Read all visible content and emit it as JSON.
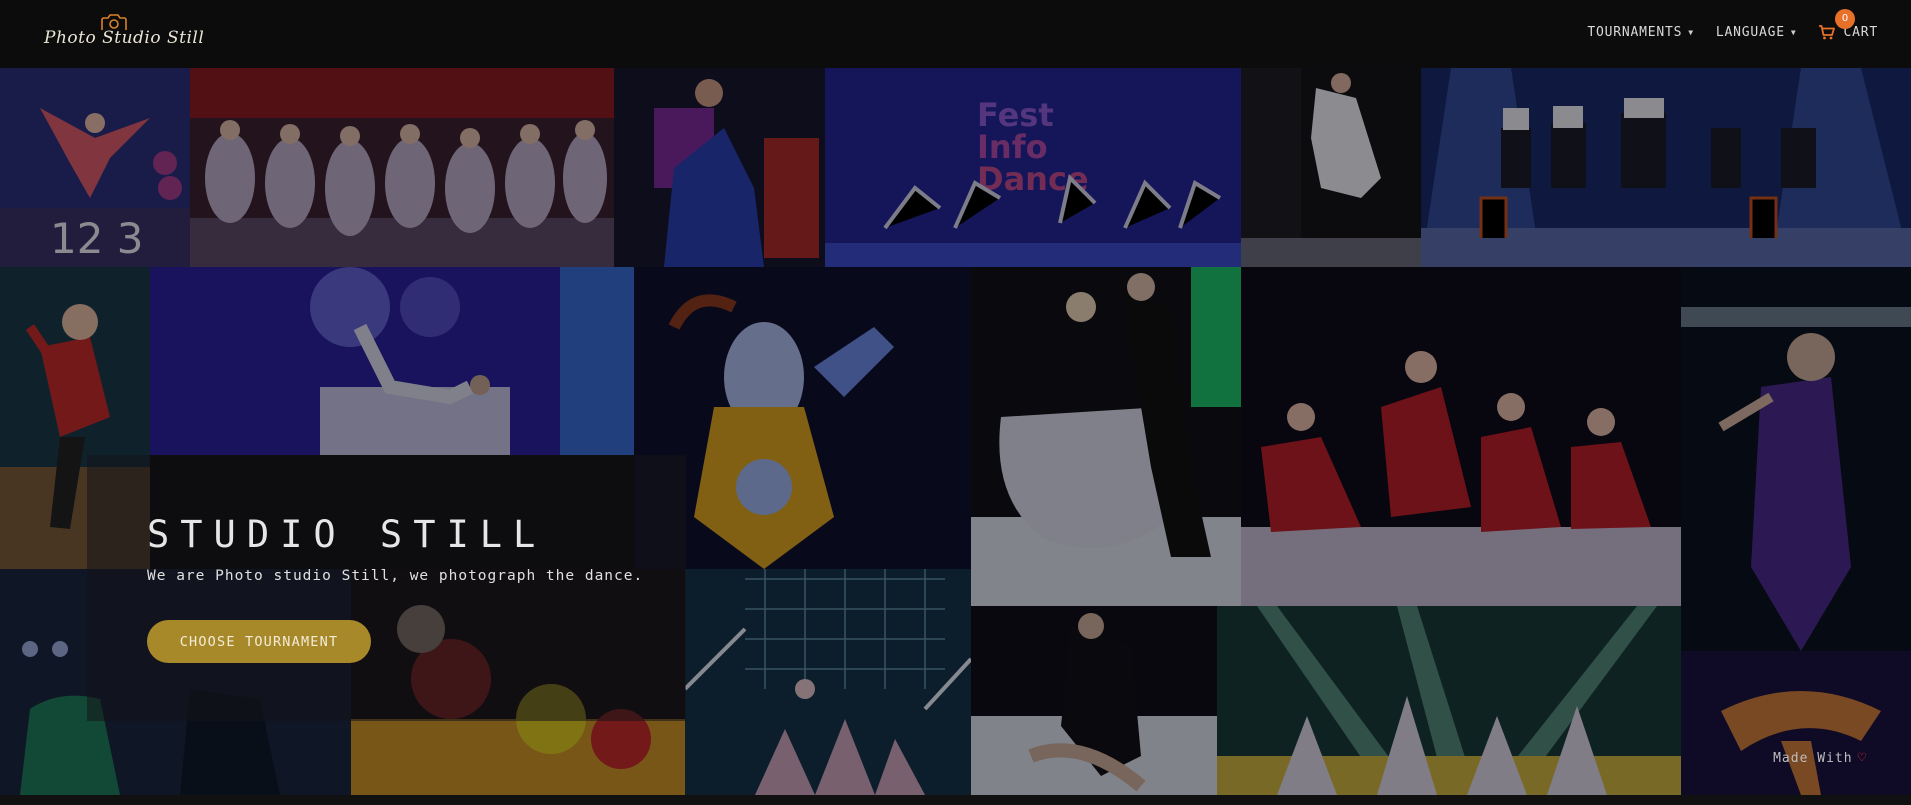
{
  "brand": {
    "name": "Photo Studio Still"
  },
  "nav": {
    "tournaments": "TOURNAMENTS",
    "language": "LANGUAGE",
    "cart_label": "CART",
    "cart_count": "0"
  },
  "hero": {
    "title": "STUDIO STILL",
    "subtitle": "We are Photo studio Still, we photograph the dance.",
    "button": "CHOOSE TOURNAMENT"
  },
  "footer": {
    "made_with": "Made With"
  },
  "colors": {
    "accent": "#a8892a",
    "badge": "#e8712a",
    "heart": "#e33333"
  },
  "icons": [
    "camera-icon",
    "chevron-down-icon",
    "cart-icon",
    "heart-icon"
  ]
}
